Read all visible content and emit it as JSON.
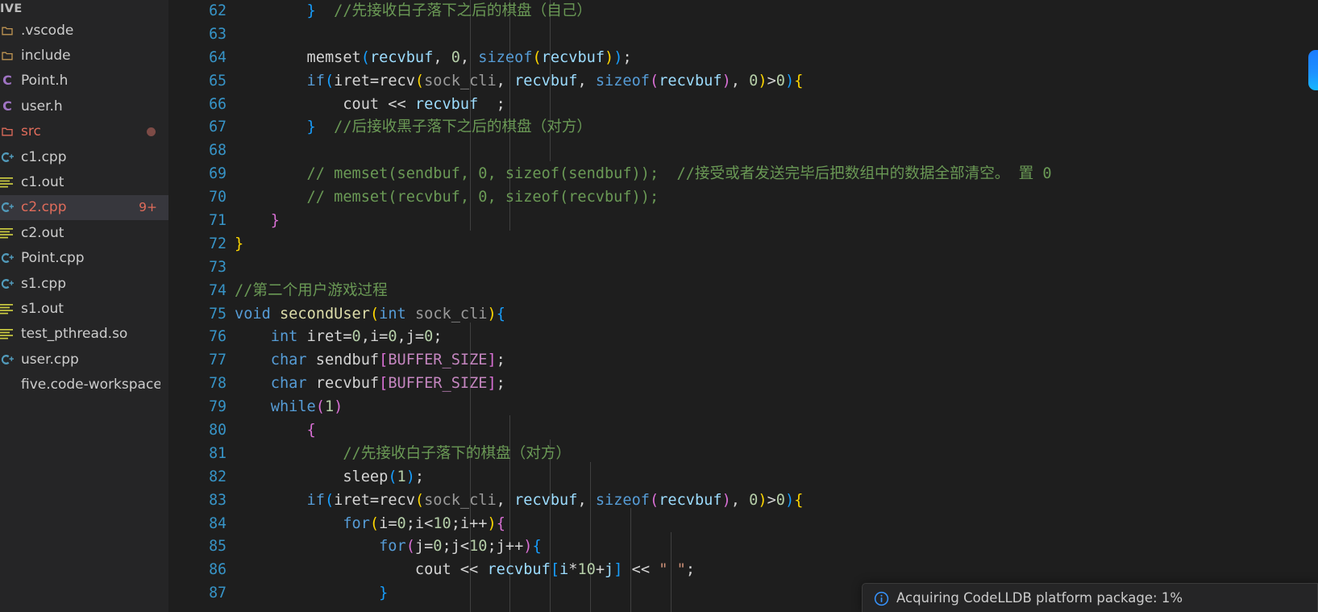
{
  "sidebar": {
    "title": "IVE",
    "items": [
      {
        "label": ".vscode",
        "icon": "folder-icon",
        "icon_char": "",
        "depth": 1,
        "selected": false,
        "color": "#cccccc",
        "icon_color": "#c09553",
        "badge": "",
        "dot": false
      },
      {
        "label": "include",
        "icon": "folder-icon",
        "icon_char": "",
        "depth": 1,
        "selected": false,
        "color": "#cccccc",
        "icon_color": "#c09553",
        "badge": "",
        "dot": false
      },
      {
        "label": "Point.h",
        "icon": "c-header-icon",
        "icon_char": "C",
        "depth": 2,
        "selected": false,
        "color": "#cccccc",
        "icon_color": "#a074c4",
        "badge": "",
        "dot": false
      },
      {
        "label": "user.h",
        "icon": "c-header-icon",
        "icon_char": "C",
        "depth": 2,
        "selected": false,
        "color": "#cccccc",
        "icon_color": "#a074c4",
        "badge": "",
        "dot": false
      },
      {
        "label": "src",
        "icon": "folder-open-icon",
        "icon_char": "",
        "depth": 1,
        "selected": false,
        "color": "#e06c5b",
        "icon_color": "#e06c5b",
        "badge": "",
        "dot": true
      },
      {
        "label": "c1.cpp",
        "icon": "cpp-file-icon",
        "icon_char": "",
        "depth": 2,
        "selected": false,
        "color": "#cccccc",
        "icon_color": "#519aba",
        "badge": "",
        "dot": false
      },
      {
        "label": "c1.out",
        "icon": "binary-file-icon",
        "icon_char": "",
        "depth": 2,
        "selected": false,
        "color": "#cccccc",
        "icon_color": "#cbcb41",
        "badge": "",
        "dot": false
      },
      {
        "label": "c2.cpp",
        "icon": "cpp-file-icon",
        "icon_char": "",
        "depth": 2,
        "selected": true,
        "color": "#e06c5b",
        "icon_color": "#519aba",
        "badge": "9+",
        "dot": false
      },
      {
        "label": "c2.out",
        "icon": "binary-file-icon",
        "icon_char": "",
        "depth": 2,
        "selected": false,
        "color": "#cccccc",
        "icon_color": "#cbcb41",
        "badge": "",
        "dot": false
      },
      {
        "label": "Point.cpp",
        "icon": "cpp-file-icon",
        "icon_char": "",
        "depth": 2,
        "selected": false,
        "color": "#cccccc",
        "icon_color": "#519aba",
        "badge": "",
        "dot": false
      },
      {
        "label": "s1.cpp",
        "icon": "cpp-file-icon",
        "icon_char": "",
        "depth": 2,
        "selected": false,
        "color": "#cccccc",
        "icon_color": "#519aba",
        "badge": "",
        "dot": false
      },
      {
        "label": "s1.out",
        "icon": "binary-file-icon",
        "icon_char": "",
        "depth": 2,
        "selected": false,
        "color": "#cccccc",
        "icon_color": "#cbcb41",
        "badge": "",
        "dot": false
      },
      {
        "label": "test_pthread.so",
        "icon": "binary-file-icon",
        "icon_char": "",
        "depth": 2,
        "selected": false,
        "color": "#cccccc",
        "icon_color": "#cbcb41",
        "badge": "",
        "dot": false
      },
      {
        "label": "user.cpp",
        "icon": "cpp-file-icon",
        "icon_char": "",
        "depth": 2,
        "selected": false,
        "color": "#cccccc",
        "icon_color": "#519aba",
        "badge": "",
        "dot": false
      },
      {
        "label": "five.code-workspace",
        "icon": "workspace-icon",
        "icon_char": "",
        "depth": 1,
        "selected": false,
        "color": "#cccccc",
        "icon_color": "#9a9a9a",
        "badge": "",
        "dot": false
      }
    ]
  },
  "editor": {
    "language": "cpp",
    "first_visible_line": 62,
    "lines": [
      {
        "n": 62,
        "html": "<span class=\"b-b\">        }</span><span class=\"t-cmt\">  //先接收白子落下之后的棋盘（自己）</span>"
      },
      {
        "n": 63,
        "html": ""
      },
      {
        "n": 64,
        "html": "<span class=\"t-plain\">        memset</span><span class=\"b-b\">(</span><span class=\"t-var\">recvbuf</span><span class=\"t-plain\">, </span><span class=\"t-num\">0</span><span class=\"t-plain\">, </span><span class=\"t-kw\">sizeof</span><span class=\"b-y\">(</span><span class=\"t-var\">recvbuf</span><span class=\"b-y\">)</span><span class=\"b-b\">)</span><span class=\"t-plain\">;</span>"
      },
      {
        "n": 65,
        "html": "<span class=\"t-kw\">        if</span><span class=\"b-b\">(</span><span class=\"t-plain\">iret=recv</span><span class=\"b-y\">(</span><span class=\"t-param\">sock_cli</span><span class=\"t-plain\">, </span><span class=\"t-var\">recvbuf</span><span class=\"t-plain\">, </span><span class=\"t-kw\">sizeof</span><span class=\"b-p\">(</span><span class=\"t-var\">recvbuf</span><span class=\"b-p\">)</span><span class=\"t-plain\">, </span><span class=\"t-num\">0</span><span class=\"b-y\">)</span><span class=\"t-plain\">&gt;</span><span class=\"t-num\">0</span><span class=\"b-b\">)</span><span class=\"b-y\">{</span>"
      },
      {
        "n": 66,
        "html": "<span class=\"t-plain\">            cout &lt;&lt; </span><span class=\"t-var\">recvbuf</span><span class=\"t-plain\">  ;</span>"
      },
      {
        "n": 67,
        "html": "<span class=\"b-b\">        }</span><span class=\"t-cmt\">  //后接收黑子落下之后的棋盘（对方）</span>"
      },
      {
        "n": 68,
        "html": ""
      },
      {
        "n": 69,
        "html": "<span class=\"t-cmt\">        // memset(sendbuf, 0, sizeof(sendbuf));  //接受或者发送完毕后把数组中的数据全部清空。 置 0</span>"
      },
      {
        "n": 70,
        "html": "<span class=\"t-cmt\">        // memset(recvbuf, 0, sizeof(recvbuf));</span>"
      },
      {
        "n": 71,
        "html": "<span class=\"b-p\">    }</span>"
      },
      {
        "n": 72,
        "html": "<span class=\"b-y\">}</span>"
      },
      {
        "n": 73,
        "html": ""
      },
      {
        "n": 74,
        "html": "<span class=\"t-cmt\">//第二个用户游戏过程</span>"
      },
      {
        "n": 75,
        "html": "<span class=\"t-kw\">void</span><span class=\"t-plain\"> </span><span class=\"t-fn\">secondUser</span><span class=\"b-y\">(</span><span class=\"t-kw\">int</span><span class=\"t-plain\"> </span><span class=\"t-param\">sock_cli</span><span class=\"b-y\">)</span><span class=\"b-b\">{</span>"
      },
      {
        "n": 76,
        "html": "<span class=\"t-kw\">    int</span><span class=\"t-plain\"> iret=</span><span class=\"t-num\">0</span><span class=\"t-plain\">,i=</span><span class=\"t-num\">0</span><span class=\"t-plain\">,j=</span><span class=\"t-num\">0</span><span class=\"t-plain\">;</span>"
      },
      {
        "n": 77,
        "html": "<span class=\"t-kw\">    char</span><span class=\"t-plain\"> sendbuf</span><span class=\"b-p\">[</span><span class=\"t-macro\">BUFFER_SIZE</span><span class=\"b-p\">]</span><span class=\"t-plain\">;</span>"
      },
      {
        "n": 78,
        "html": "<span class=\"t-kw\">    char</span><span class=\"t-plain\"> recvbuf</span><span class=\"b-p\">[</span><span class=\"t-macro\">BUFFER_SIZE</span><span class=\"b-p\">]</span><span class=\"t-plain\">;</span>"
      },
      {
        "n": 79,
        "html": "<span class=\"t-kw\">    while</span><span class=\"b-p\">(</span><span class=\"t-num\">1</span><span class=\"b-p\">)</span>"
      },
      {
        "n": 80,
        "html": "<span class=\"b-p\">        {</span>"
      },
      {
        "n": 81,
        "html": "<span class=\"t-cmt\">            //先接收白子落下的棋盘（对方）</span>"
      },
      {
        "n": 82,
        "html": "<span class=\"t-plain\">            sleep</span><span class=\"b-b\">(</span><span class=\"t-num\">1</span><span class=\"b-b\">)</span><span class=\"t-plain\">;</span>"
      },
      {
        "n": 83,
        "html": "<span class=\"t-kw\">        if</span><span class=\"b-b\">(</span><span class=\"t-plain\">iret=recv</span><span class=\"b-y\">(</span><span class=\"t-param\">sock_cli</span><span class=\"t-plain\">, </span><span class=\"t-var\">recvbuf</span><span class=\"t-plain\">, </span><span class=\"t-kw\">sizeof</span><span class=\"b-p\">(</span><span class=\"t-var\">recvbuf</span><span class=\"b-p\">)</span><span class=\"t-plain\">, </span><span class=\"t-num\">0</span><span class=\"b-y\">)</span><span class=\"t-plain\">&gt;</span><span class=\"t-num\">0</span><span class=\"b-b\">)</span><span class=\"b-y\">{</span>"
      },
      {
        "n": 84,
        "html": "<span class=\"t-kw\">            for</span><span class=\"b-y\">(</span><span class=\"t-plain\">i=</span><span class=\"t-num\">0</span><span class=\"t-plain\">;i&lt;</span><span class=\"t-num\">10</span><span class=\"t-plain\">;i++</span><span class=\"b-y\">)</span><span class=\"b-p\">{</span>"
      },
      {
        "n": 85,
        "html": "<span class=\"t-kw\">                for</span><span class=\"b-p\">(</span><span class=\"t-plain\">j=</span><span class=\"t-num\">0</span><span class=\"t-plain\">;j&lt;</span><span class=\"t-num\">10</span><span class=\"t-plain\">;j++</span><span class=\"b-p\">)</span><span class=\"b-b\">{</span>"
      },
      {
        "n": 86,
        "html": "<span class=\"t-plain\">                    cout &lt;&lt; </span><span class=\"t-var\">recvbuf</span><span class=\"b-b\">[</span><span class=\"t-var\">i</span><span class=\"t-plain\">*</span><span class=\"t-num\">10</span><span class=\"t-plain\">+</span><span class=\"t-var\">j</span><span class=\"b-b\">]</span><span class=\"t-plain\"> &lt;&lt; </span><span class=\"t-str\">\" \"</span><span class=\"t-plain\">;</span>"
      },
      {
        "n": 87,
        "html": "<span class=\"b-b\">                }</span>"
      }
    ],
    "indent_guides_x": [
      374,
      423,
      473,
      523,
      573,
      623,
      673
    ]
  },
  "notification": {
    "icon": "info-icon",
    "message": "Acquiring CodeLLDB platform package: 1%"
  },
  "colors": {
    "sidebar_bg": "#252526",
    "editor_bg": "#1e1e1e",
    "selection_bg": "#37373d",
    "line_number": "#3794c7",
    "accent_red": "#e06c5b",
    "accent_blue": "#1e90ff",
    "comment_green": "#6a9955"
  }
}
